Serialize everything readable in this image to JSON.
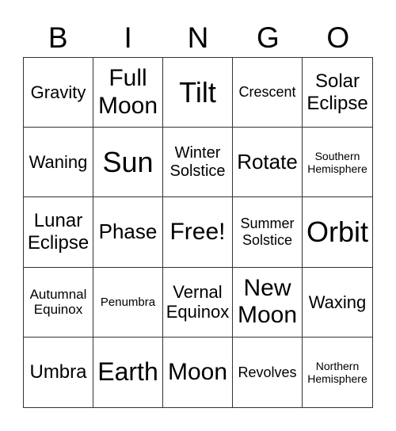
{
  "header": [
    "B",
    "I",
    "N",
    "G",
    "O"
  ],
  "cells": [
    "Gravity",
    "Full Moon",
    "Tilt",
    "Crescent",
    "Solar Eclipse",
    "Waning",
    "Sun",
    "Winter Solstice",
    "Rotate",
    "Southern Hemisphere",
    "Lunar Eclipse",
    "Phase",
    "Free!",
    "Summer Solstice",
    "Orbit",
    "Autumnal Equinox",
    "Penumbra",
    "Vernal Equinox",
    "New Moon",
    "Waxing",
    "Umbra",
    "Earth",
    "Moon",
    "Revolves",
    "Northern Hemisphere"
  ]
}
